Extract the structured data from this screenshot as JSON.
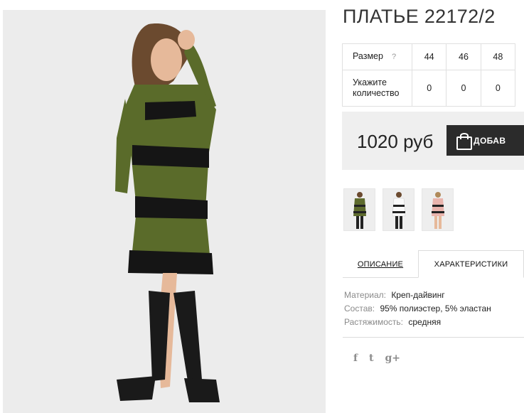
{
  "product": {
    "title": "ПЛАТЬЕ 22172/2",
    "price": "1020 руб",
    "add_button_label": "ДОБАВ"
  },
  "size_table": {
    "size_label": "Размер",
    "help_mark": "?",
    "sizes": [
      "44",
      "46",
      "48"
    ],
    "quantity_label_line1": "Укажите",
    "quantity_label_line2": "количество",
    "quantities": [
      "0",
      "0",
      "0"
    ]
  },
  "thumbnails": [
    {
      "color": "#5e6b2e",
      "alt": "olive"
    },
    {
      "color": "#f2f2f2",
      "alt": "white"
    },
    {
      "color": "#e9b4ad",
      "alt": "pink"
    }
  ],
  "tabs": {
    "description": "ОПИСАНИЕ",
    "characteristics": "ХАРАКТЕРИСТИКИ"
  },
  "specs": [
    {
      "key": "Материал:",
      "value": "Креп-дайвинг"
    },
    {
      "key": "Состав:",
      "value": "95% полиэстер, 5% эластан"
    },
    {
      "key": "Растяжимость:",
      "value": "средняя"
    }
  ],
  "social": {
    "facebook": "f",
    "twitter": "t",
    "googleplus": "g+"
  },
  "colors": {
    "dress_olive": "#5a6b2a",
    "button_dark": "#2b2b2b",
    "price_bg": "#efefef"
  }
}
